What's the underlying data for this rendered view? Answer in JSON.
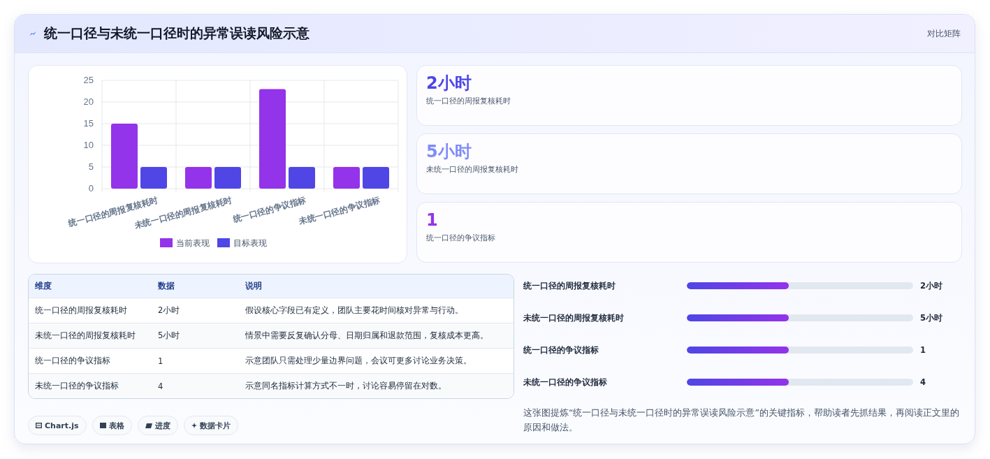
{
  "header": {
    "title": "统一口径与未统一口径时的异常误读风险示意",
    "tag": "对比矩阵"
  },
  "chart": {
    "chart_data": {
      "type": "bar",
      "categories": [
        "统一口径的周报复核耗时",
        "未统一口径的周报复核耗时",
        "统一口径的争议指标",
        "未统一口径的争议指标"
      ],
      "series": [
        {
          "name": "当前表现",
          "color": "#9333ea",
          "values": [
            15,
            5,
            23,
            5
          ]
        },
        {
          "name": "目标表现",
          "color": "#4f46e5",
          "values": [
            5,
            5,
            5,
            5
          ]
        }
      ],
      "ylim": [
        0,
        25
      ],
      "grid": true,
      "legend": "bottom",
      "yticks": [
        0,
        5,
        10,
        15,
        20,
        25
      ]
    }
  },
  "stats": [
    {
      "value": "2小时",
      "label": "统一口径的周报复核耗时",
      "color": "#4f46e5"
    },
    {
      "value": "5小时",
      "label": "未统一口径的周报复核耗时",
      "color": "#818cf8"
    },
    {
      "value": "1",
      "label": "统一口径的争议指标",
      "color": "#9333ea"
    }
  ],
  "table": {
    "columns": [
      "维度",
      "数据",
      "说明"
    ],
    "rows": [
      [
        "统一口径的周报复核耗时",
        "2小时",
        "假设核心字段已有定义，团队主要花时间核对异常与行动。"
      ],
      [
        "未统一口径的周报复核耗时",
        "5小时",
        "情景中需要反复确认分母、日期归属和退款范围，复核成本更高。"
      ],
      [
        "统一口径的争议指标",
        "1",
        "示意团队只需处理少量边界问题，会议可更多讨论业务决策。"
      ],
      [
        "未统一口径的争议指标",
        "4",
        "示意同名指标计算方式不一时，讨论容易停留在对数。"
      ]
    ]
  },
  "chips": [
    "Chart.js",
    "表格",
    "进度",
    "数据卡片"
  ],
  "progress": [
    {
      "label": "统一口径的周报复核耗时",
      "level": 0.45,
      "value": "2小时"
    },
    {
      "label": "未统一口径的周报复核耗时",
      "level": 0.45,
      "value": "5小时"
    },
    {
      "label": "统一口径的争议指标",
      "level": 0.45,
      "value": "1"
    },
    {
      "label": "未统一口径的争议指标",
      "level": 0.45,
      "value": "4"
    }
  ],
  "summary": "这张图提炼“统一口径与未统一口径时的异常误读风险示意”的关键指标，帮助读者先抓结果，再阅读正文里的原因和做法。"
}
